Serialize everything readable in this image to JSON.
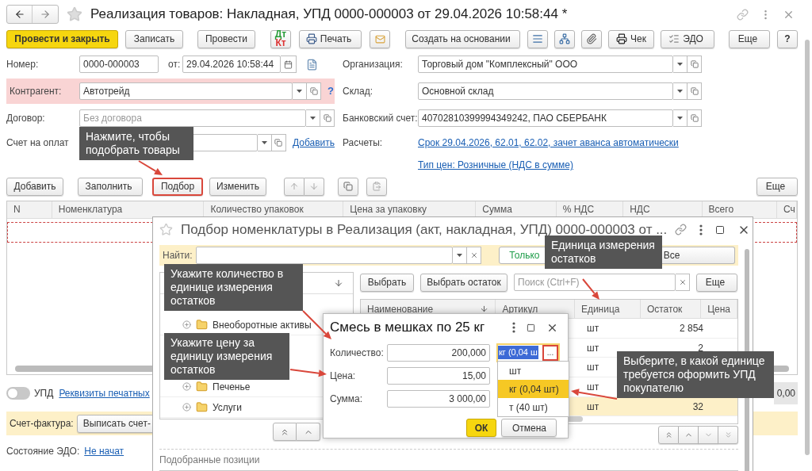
{
  "title_bar": {
    "title": "Реализация товаров: Накладная, УПД 0000-000003 от 29.04.2026 10:58:44 *"
  },
  "toolbar": {
    "post_and_close": "Провести и закрыть",
    "save": "Записать",
    "post": "Провести",
    "dt": "Дт",
    "kt": "Кт",
    "print": "Печать",
    "create_based_on": "Создать на основании",
    "receipt": "Чек",
    "edo": "ЭДО",
    "more": "Еще",
    "help": "?"
  },
  "form": {
    "number": {
      "label": "Номер:",
      "value": "0000-000003"
    },
    "date": {
      "label": "от:",
      "value": "29.04.2026 10:58:44"
    },
    "counterparty": {
      "label": "Контрагент:",
      "value": "Автотрейд",
      "highlighted": true,
      "hint": "?"
    },
    "contract": {
      "label": "Договор:",
      "placeholder": "Без договора"
    },
    "payment_invoice": {
      "label": "Счет на оплат",
      "link": "Добавить"
    },
    "organization": {
      "label": "Организация:",
      "value": "Торговый дом \"Комплексный\" ООО"
    },
    "warehouse": {
      "label": "Склад:",
      "value": "Основной склад"
    },
    "bank_account": {
      "label": "Банковский счет:",
      "value": "40702810399994349242, ПАО СБЕРБАНК"
    },
    "settlements": {
      "label": "Расчеты:",
      "link": "Срок 29.04.2026, 62.01, 62.02, зачет аванса автоматически"
    },
    "price_type": {
      "link": "Тип цен: Розничные (НДС в сумме)"
    }
  },
  "table_toolbar": {
    "add": "Добавить",
    "fill": "Заполнить",
    "pick": {
      "label": "Подбор",
      "highlighted": true
    },
    "change": "Изменить",
    "more": "Еще"
  },
  "table": {
    "columns": [
      "N",
      "Номенклатура",
      "Количество упаковок",
      "Цена за упаковку",
      "Сумма",
      "% НДС",
      "НДС",
      "Всего",
      "Сч"
    ]
  },
  "footer": {
    "upd": {
      "label": "УПД",
      "on": false
    },
    "print_details_link": "Реквизиты печатных",
    "total": "0,00",
    "invoice": {
      "label": "Счет-фактура:",
      "button": "Выписать счет-"
    },
    "edo_status": {
      "label": "Состояние ЭДО:",
      "link": "Не начат"
    }
  },
  "pick_window": {
    "title": "Подбор номенклатуры в Реализация (акт, накладная, УПД) 0000-000003 от ...",
    "find_label": "Найти:",
    "filters": [
      {
        "label": "Только",
        "selected": true
      },
      {
        "label": "Все",
        "selected": false
      }
    ],
    "tree": [
      {
        "label": "Внеоборотные активы",
        "expanded": false
      },
      {
        "label": "Печенье",
        "expanded": false
      },
      {
        "label": "Услуги",
        "expanded": false
      }
    ],
    "buttons": {
      "select": "Выбрать",
      "select_rest": "Выбрать остаток",
      "search_placeholder": "Поиск (Ctrl+F)",
      "more": "Еще"
    },
    "columns": [
      "Наименование",
      "Артикул",
      "Единица",
      "Остаток",
      "Цена"
    ],
    "rows": [
      {
        "unit": "шт",
        "stock": "2 854",
        "selected": false
      },
      {
        "unit": "шт",
        "stock": "2",
        "selected": false
      },
      {
        "unit": "шт",
        "selected": false
      },
      {
        "unit": "шт",
        "selected": false
      },
      {
        "unit": "шт",
        "stock": "32",
        "selected": true
      }
    ],
    "picked_label": "Подобранные позиции"
  },
  "item_dialog": {
    "title": "Смесь в мешках по 25 кг",
    "fields": [
      {
        "label": "Количество:",
        "value": "200,000"
      },
      {
        "label": "Цена:",
        "value": "15,00"
      },
      {
        "label": "Сумма:",
        "value": "3 000,00"
      }
    ],
    "unit_value": "кг (0,04 ш",
    "unit_button": {
      "label": "...",
      "highlighted": true
    },
    "unit_options": [
      {
        "label": "шт",
        "selected": false
      },
      {
        "label": "кг (0,04 шт)",
        "selected": true
      },
      {
        "label": "т (40 шт)",
        "selected": false
      }
    ],
    "ok": "ОК",
    "cancel": "Отмена"
  },
  "callouts": [
    {
      "text": "Нажмите, чтобы подобрать товары"
    },
    {
      "text": "Укажите количество в единице измерения остатков"
    },
    {
      "text": "Укажите цену за единицу измерения остатков"
    },
    {
      "text": "Единица измерения остатков"
    },
    {
      "text": "Выберите, в какой единице требуется оформить УПД покупателю"
    }
  ]
}
